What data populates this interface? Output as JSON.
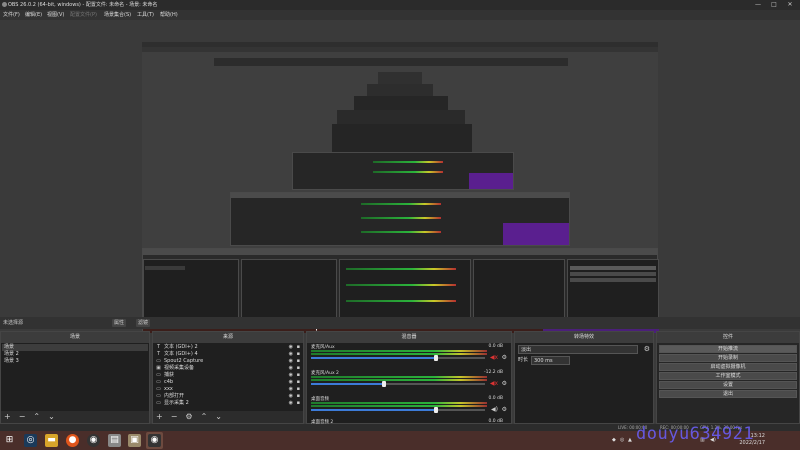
{
  "window": {
    "title": "OBS 26.0.2 (64-bit, windows) - 配置文件: 未命名 - 场景: 未命名",
    "controls": [
      "—",
      "□",
      "✕"
    ]
  },
  "menu": [
    {
      "label": "文件(F)",
      "enabled": true
    },
    {
      "label": "编辑(E)",
      "enabled": true
    },
    {
      "label": "视图(V)",
      "enabled": true
    },
    {
      "label": "配置文件(P)",
      "enabled": false
    },
    {
      "label": "场景集合(S)",
      "enabled": true
    },
    {
      "label": "工具(T)",
      "enabled": true
    },
    {
      "label": "帮助(H)",
      "enabled": true
    }
  ],
  "context_bar": {
    "label": "未选择源",
    "properties": "属性",
    "filters": "滤镜"
  },
  "scenes": {
    "title": "场景",
    "items": [
      "场景",
      "场景 2",
      "场景 3"
    ],
    "selected": 0
  },
  "sources": {
    "title": "来源",
    "items": [
      {
        "icon": "T",
        "name": "文本 (GDI+) 2"
      },
      {
        "icon": "T",
        "name": "文本 (GDI+) 4"
      },
      {
        "icon": "▭",
        "name": "Spout2 Capture"
      },
      {
        "icon": "▣",
        "name": "视频采集设备"
      },
      {
        "icon": "▭",
        "name": "捕获"
      },
      {
        "icon": "▭",
        "name": "c4b"
      },
      {
        "icon": "▭",
        "name": "xxx"
      },
      {
        "icon": "▭",
        "name": "内部打开"
      },
      {
        "icon": "▭",
        "name": "显示采集 2"
      }
    ]
  },
  "mixer": {
    "title": "混音器",
    "channels": [
      {
        "name": "麦克风/Aux",
        "db": "0.0 dB",
        "level": 0.72
      },
      {
        "name": "麦克风/Aux 2",
        "db": "-12.2 dB",
        "level": 0.42
      },
      {
        "name": "桌面音频",
        "db": "0.0 dB",
        "level": 0.72
      },
      {
        "name": "桌面音频 2",
        "db": "0.0 dB",
        "level": 0.72
      }
    ]
  },
  "transitions": {
    "title": "转场特效",
    "selected": "淡出",
    "duration_label": "时长",
    "duration_value": "300 ms"
  },
  "controls": {
    "title": "控件",
    "buttons": [
      "开始推流",
      "开始录制",
      "启动虚拟摄像机",
      "工作室模式",
      "设置",
      "退出"
    ]
  },
  "status": {
    "live": "LIVE: 00:00:00",
    "rec": "REC: 00:00:00",
    "cpu": "CPU: 1.2%, 30.00 fps"
  },
  "taskbar": {
    "time": "13:12",
    "date": "2022/2/17"
  },
  "watermark": "douyu634921",
  "colors": {
    "accent_blue": "#3c7bd8",
    "mute_red": "#d33333",
    "taskbar": "#4a2e2a",
    "watermark": "#6a5df2"
  }
}
